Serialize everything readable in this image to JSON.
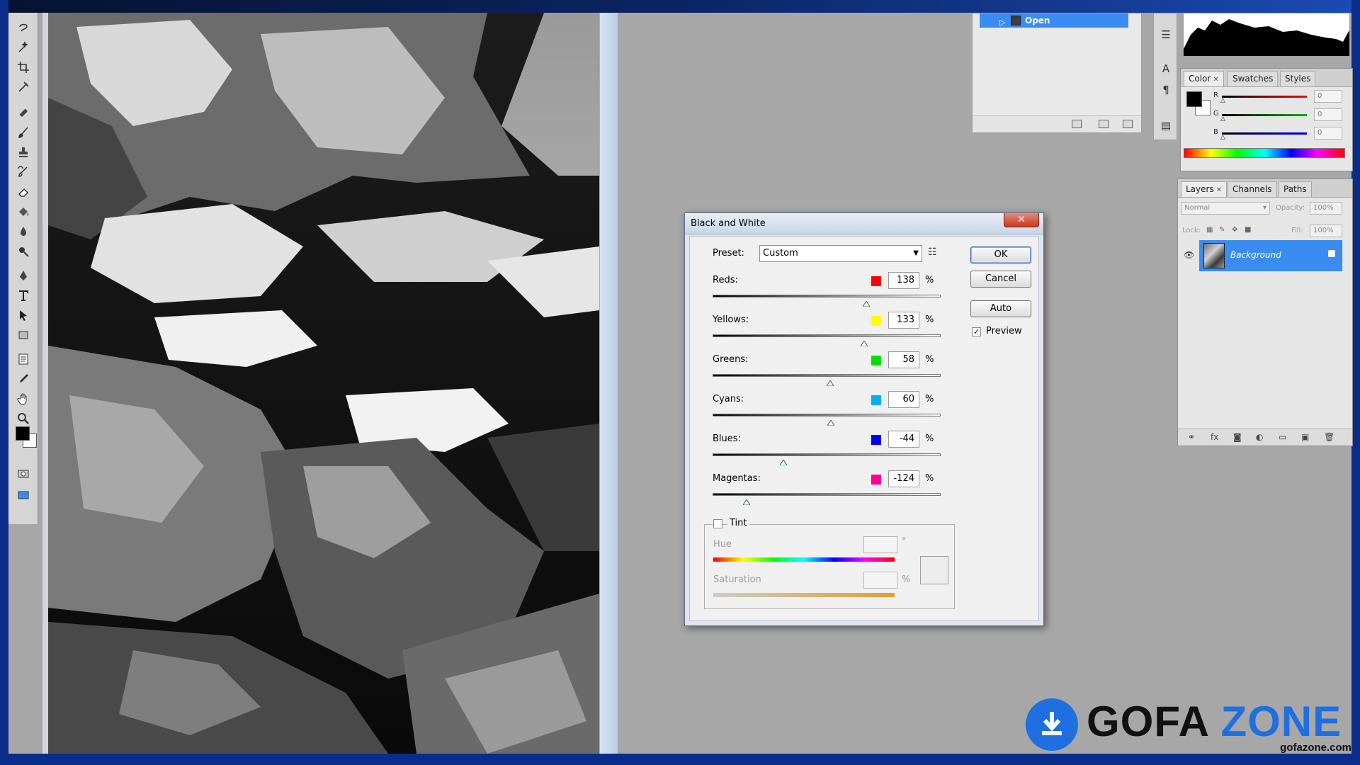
{
  "history": {
    "open_label": "Open"
  },
  "color_panel": {
    "tabs": [
      "Color",
      "Swatches",
      "Styles"
    ],
    "channels": [
      {
        "label": "R",
        "value": "0",
        "color": "#ff0000"
      },
      {
        "label": "G",
        "value": "0",
        "color": "#00b000"
      },
      {
        "label": "B",
        "value": "0",
        "color": "#0000ff"
      }
    ]
  },
  "layers_panel": {
    "tabs": [
      "Layers",
      "Channels",
      "Paths"
    ],
    "blend_mode": "Normal",
    "opacity_label": "Opacity:",
    "opacity_value": "100%",
    "lock_label": "Lock:",
    "fill_label": "Fill:",
    "fill_value": "100%",
    "layer_name": "Background"
  },
  "dialog": {
    "title": "Black and White",
    "close_glyph": "✕",
    "preset_label": "Preset:",
    "preset_value": "Custom",
    "buttons": {
      "ok": "OK",
      "cancel": "Cancel",
      "auto": "Auto"
    },
    "preview_label": "Preview",
    "preview_checked": true,
    "sliders": [
      {
        "label": "Reds:",
        "value": "138",
        "color": "#ff0000",
        "fraction": 0.675
      },
      {
        "label": "Yellows:",
        "value": "133",
        "color": "#ffff00",
        "fraction": 0.665
      },
      {
        "label": "Greens:",
        "value": "58",
        "color": "#00e000",
        "fraction": 0.515
      },
      {
        "label": "Cyans:",
        "value": "60",
        "color": "#00b0f0",
        "fraction": 0.52
      },
      {
        "label": "Blues:",
        "value": "-44",
        "color": "#0000ff",
        "fraction": 0.31
      },
      {
        "label": "Magentas:",
        "value": "-124",
        "color": "#ff0090",
        "fraction": 0.15
      }
    ],
    "percent_sign": "%",
    "tint": {
      "label": "Tint",
      "hue_label": "Hue",
      "hue_unit": "°",
      "saturation_label": "Saturation",
      "saturation_unit": "%"
    }
  },
  "watermark": {
    "brand_left": "GOFA",
    "brand_right": "ZONE",
    "url": "gofazone.com"
  }
}
